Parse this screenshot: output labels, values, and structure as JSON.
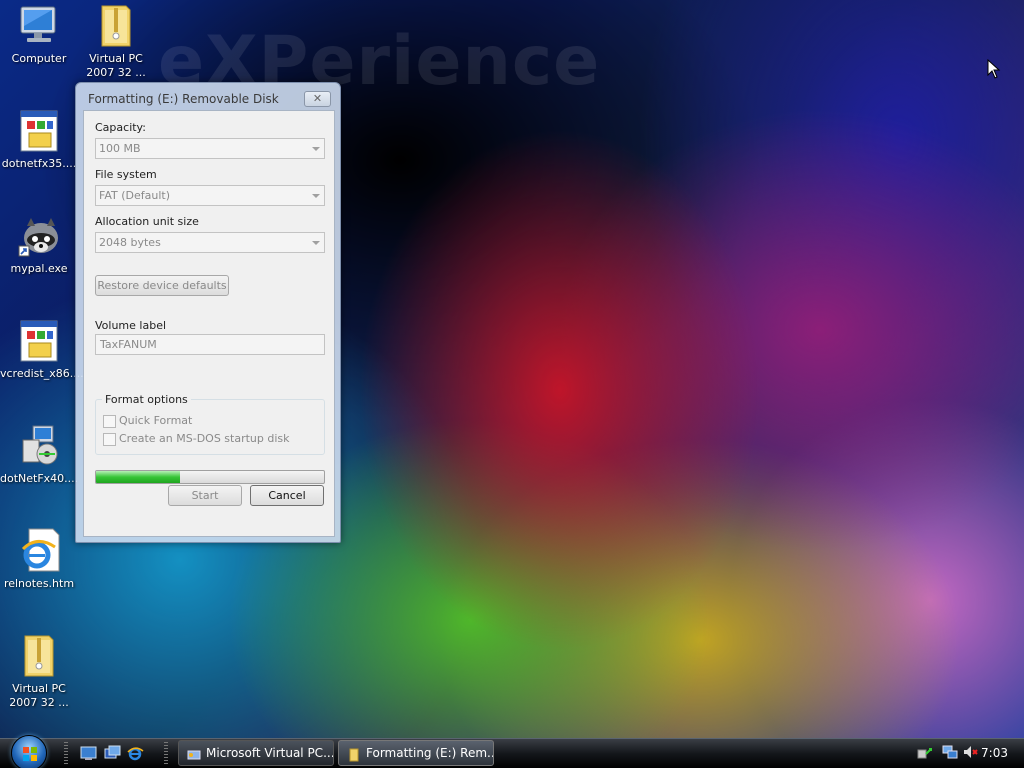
{
  "wallpaper": {
    "watermark": "eXPerience"
  },
  "desktop_icons": [
    {
      "label": "Computer"
    },
    {
      "label": "Virtual PC 2007 32 ..."
    },
    {
      "label": "dotnetfx35...."
    },
    {
      "label": "mypal.exe"
    },
    {
      "label": "vcredist_x86...."
    },
    {
      "label": "dotNetFx40...."
    },
    {
      "label": "relnotes.htm"
    },
    {
      "label": "Virtual PC 2007 32 ..."
    }
  ],
  "dialog": {
    "title": "Formatting (E:) Removable Disk",
    "close_glyph": "✕",
    "capacity_label": "Capacity:",
    "capacity_value": "100 MB",
    "filesystem_label": "File system",
    "filesystem_value": "FAT (Default)",
    "allocation_label": "Allocation unit size",
    "allocation_value": "2048 bytes",
    "restore_button": "Restore device defaults",
    "volume_label": "Volume label",
    "volume_value": "TaxFANUM",
    "format_options_label": "Format options",
    "quick_format": "Quick Format",
    "msdos_disk": "Create an MS-DOS startup disk",
    "progress_percent": 37,
    "start_button": "Start",
    "cancel_button": "Cancel"
  },
  "taskbar": {
    "tasks": [
      {
        "label": "Microsoft Virtual PC..."
      },
      {
        "label": "Formatting (E:) Rem..."
      }
    ],
    "clock": "7:03"
  },
  "colors": {
    "progress_fill": "#37c537",
    "accent": "#2066b8"
  }
}
